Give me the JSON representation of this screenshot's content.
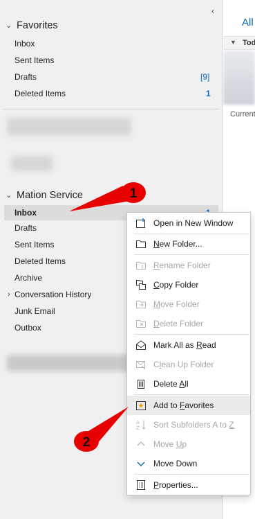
{
  "pane": {
    "collapse_glyph": "‹",
    "favorites": {
      "label": "Favorites",
      "items": [
        {
          "label": "Inbox",
          "count": ""
        },
        {
          "label": "Sent Items",
          "count": ""
        },
        {
          "label": "Drafts",
          "count": "[9]"
        },
        {
          "label": "Deleted Items",
          "count": "1"
        }
      ]
    },
    "account": {
      "label": "Mation Service",
      "items": [
        {
          "label": "Inbox",
          "count": "1"
        },
        {
          "label": "Drafts"
        },
        {
          "label": "Sent Items"
        },
        {
          "label": "Deleted Items"
        },
        {
          "label": "Archive"
        },
        {
          "label": "Conversation History"
        },
        {
          "label": "Junk Email"
        },
        {
          "label": "Outbox"
        }
      ]
    }
  },
  "reading": {
    "tab": "All",
    "group_header": "Tod",
    "snippet": "Current"
  },
  "context_menu": {
    "open_new_window": "Open in New Window",
    "new_folder": {
      "pre": "",
      "u": "N",
      "post": "ew Folder..."
    },
    "rename_folder": {
      "pre": "",
      "u": "R",
      "post": "ename Folder"
    },
    "copy_folder": {
      "pre": "",
      "u": "C",
      "post": "opy Folder"
    },
    "move_folder": {
      "pre": "",
      "u": "M",
      "post": "ove Folder"
    },
    "delete_folder": {
      "pre": "",
      "u": "D",
      "post": "elete Folder"
    },
    "mark_all_read": {
      "pre": "Mark All as ",
      "u": "R",
      "post": "ead"
    },
    "clean_up_folder": {
      "pre": "C",
      "u": "l",
      "post": "ean Up Folder"
    },
    "delete_all": {
      "pre": "Delete ",
      "u": "A",
      "post": "ll"
    },
    "add_to_favorites": {
      "pre": "Add to ",
      "u": "F",
      "post": "avorites"
    },
    "sort_subfolders": {
      "pre": "Sort Subfolders A to ",
      "u": "Z",
      "post": ""
    },
    "move_up": {
      "pre": "Move ",
      "u": "U",
      "post": "p"
    },
    "move_down": "Move Down",
    "properties": {
      "pre": "",
      "u": "P",
      "post": "roperties..."
    }
  },
  "annotations": {
    "callout_1": "1",
    "callout_2": "2"
  },
  "colors": {
    "accent": "#0f6cbd",
    "callout_red": "#e60000"
  }
}
